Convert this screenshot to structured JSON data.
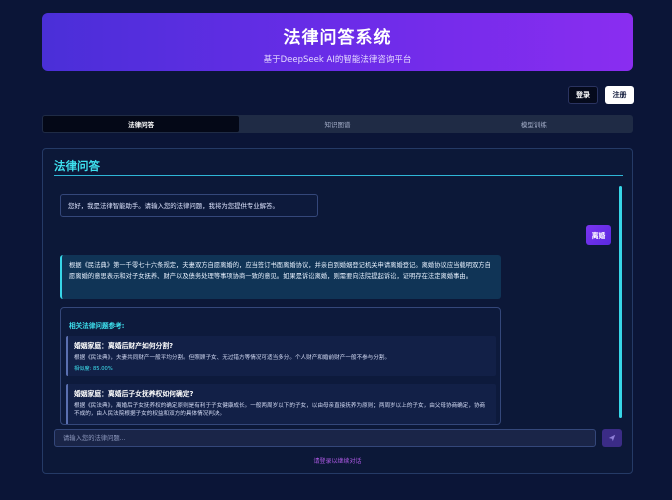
{
  "header": {
    "title": "法律问答系统",
    "subtitle": "基于DeepSeek AI的智能法律咨询平台"
  },
  "auth": {
    "login_label": "登录",
    "register_label": "注册"
  },
  "tabs": [
    {
      "label": "法律问答",
      "active": true
    },
    {
      "label": "知识图谱",
      "active": false
    },
    {
      "label": "模型训练",
      "active": false
    }
  ],
  "chat": {
    "section_title": "法律问答",
    "welcome": "您好，我是法律智能助手。请输入您的法律问题，我将为您提供专业解答。",
    "user_message": "离婚",
    "answer": "根据《民法典》第一千零七十六条规定，夫妻双方自愿离婚的，应当签订书面离婚协议，并亲自到婚姻登记机关申请离婚登记。离婚协议应当载明双方自愿离婚的意思表示和对子女抚养、财产以及债务处理等事项协商一致的意见。如果是诉讼离婚，则需要向法院提起诉讼，证明存在法定离婚事由。",
    "related_title": "相关法律问题参考:",
    "related": [
      {
        "question": "婚姻家庭：离婚后财产如何分割?",
        "answer": "根据《民法典》，夫妻共同财产一般平均分割。但照顾子女、无过错方等情况可适当多分。个人财产和婚前财产一般不参与分割。",
        "similarity": "相似度: 85.00%"
      },
      {
        "question": "婚姻家庭：离婚后子女抚养权如何确定?",
        "answer": "根据《民法典》，离婚后子女抚养权的确定原则是有利于子女健康成长。一般两周岁以下的子女，以由母亲直接抚养为原则；两周岁以上的子女，由父母协商确定，协商不成的，由人民法院根据子女的权益和双方的具体情况判决。"
      }
    ],
    "input_placeholder": "请输入您的法律问题...",
    "login_hint": "请登录以继续对话"
  },
  "colors": {
    "background": "#0b1537",
    "accent_cyan": "#3ee0ee",
    "accent_purple": "#7b34f0"
  },
  "icons": {
    "send": "send-icon"
  }
}
